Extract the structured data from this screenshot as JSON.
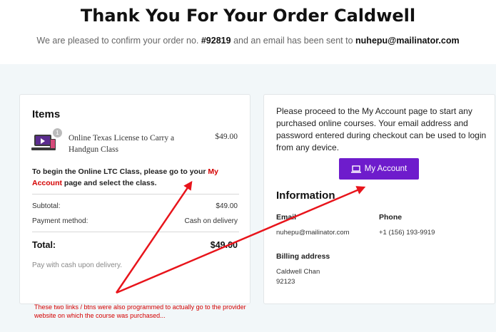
{
  "header": {
    "title": "Thank You For Your Order Caldwell",
    "confirm_prefix": "We are pleased to confirm your order no.",
    "order_number": "#92819",
    "confirm_middle": "and an email has been sent to",
    "email": "nuhepu@mailinator.com"
  },
  "items_card": {
    "title": "Items",
    "qty_badge": "1",
    "product": {
      "name": "Online Texas License to Carry a Handgun Class",
      "price": "$49.00",
      "icon": "course-device-icon"
    },
    "note_prefix": "To begin the Online LTC Class, please go to your",
    "note_link": "My Account",
    "note_suffix": "page and select the class.",
    "subtotal_label": "Subtotal:",
    "subtotal_value": "$49.00",
    "payment_label": "Payment method:",
    "payment_value": "Cash on delivery",
    "total_label": "Total:",
    "total_value": "$49.00",
    "payment_note": "Pay with cash upon delivery."
  },
  "account_card": {
    "message": "Please proceed to the My Account page to start any purchased online courses. Your email address and password entered during checkout can be used to login from any device.",
    "button_label": "My Account",
    "button_icon": "laptop-icon",
    "info_title": "Information",
    "email_label": "Email",
    "email_value": "nuhepu@mailinator.com",
    "phone_label": "Phone",
    "phone_value": "+1 (156) 193-9919",
    "billing_label": "Billing address",
    "billing_name": "Caldwell Chan",
    "billing_zip": "92123"
  },
  "annotation": {
    "text": "These two links / btns were also programmed to actually go to the provider website on which the course was purchased...",
    "color": "#d40000"
  },
  "colors": {
    "accent": "#6e1ccc",
    "link_red": "#d40000",
    "band": "#f2f7f9"
  }
}
